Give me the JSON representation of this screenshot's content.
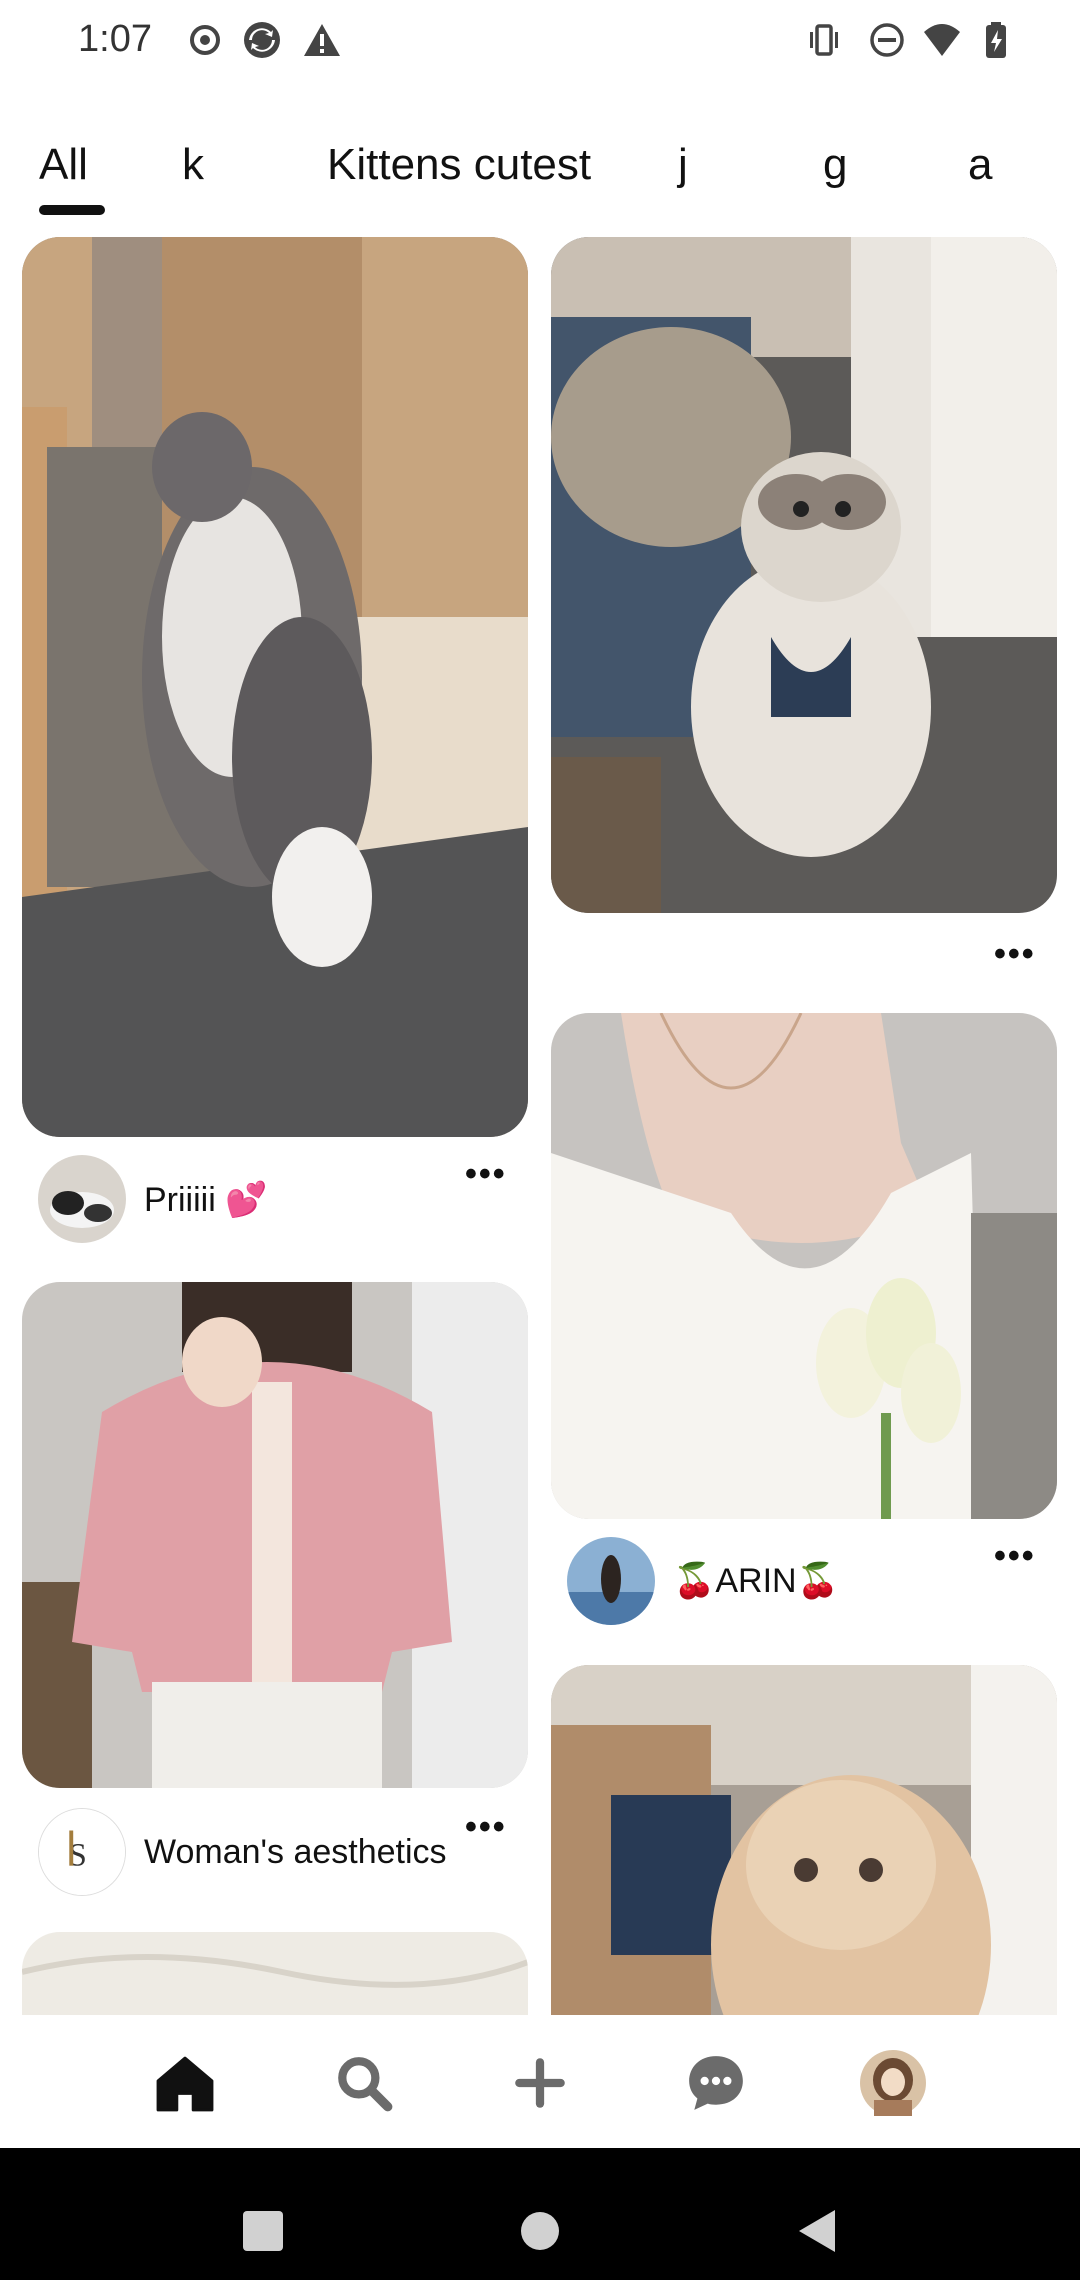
{
  "status_bar": {
    "time": "1:07",
    "icons": [
      "record-icon",
      "sync-icon",
      "warning-icon",
      "vibrate-icon",
      "dnd-icon",
      "wifi-icon",
      "battery-icon"
    ]
  },
  "tabs": [
    {
      "label": "All",
      "selected": true
    },
    {
      "label": "k"
    },
    {
      "label": "Kittens cutest"
    },
    {
      "label": "j"
    },
    {
      "label": "g"
    },
    {
      "label": "a"
    }
  ],
  "pins": [
    {
      "image": "gray-white-cat-standing",
      "author": "Priiiii 💕",
      "more": "•••"
    },
    {
      "image": "ragdoll-cat-held",
      "more": "•••"
    },
    {
      "image": "pink-cardigan-outfit",
      "author": "Woman's aesthetics",
      "more": "•••"
    },
    {
      "image": "moon-necklace-tulips",
      "author": "🍒ARIN🍒",
      "more": "•••"
    },
    {
      "image": "fluffy-kitten"
    },
    {
      "image": "white-fabric-partial"
    }
  ],
  "bottom_nav": [
    "home-icon",
    "search-icon",
    "create-icon",
    "messages-icon",
    "profile-avatar"
  ],
  "colors": {
    "text": "#111111",
    "background": "#ffffff",
    "system_nav": "#000000"
  }
}
